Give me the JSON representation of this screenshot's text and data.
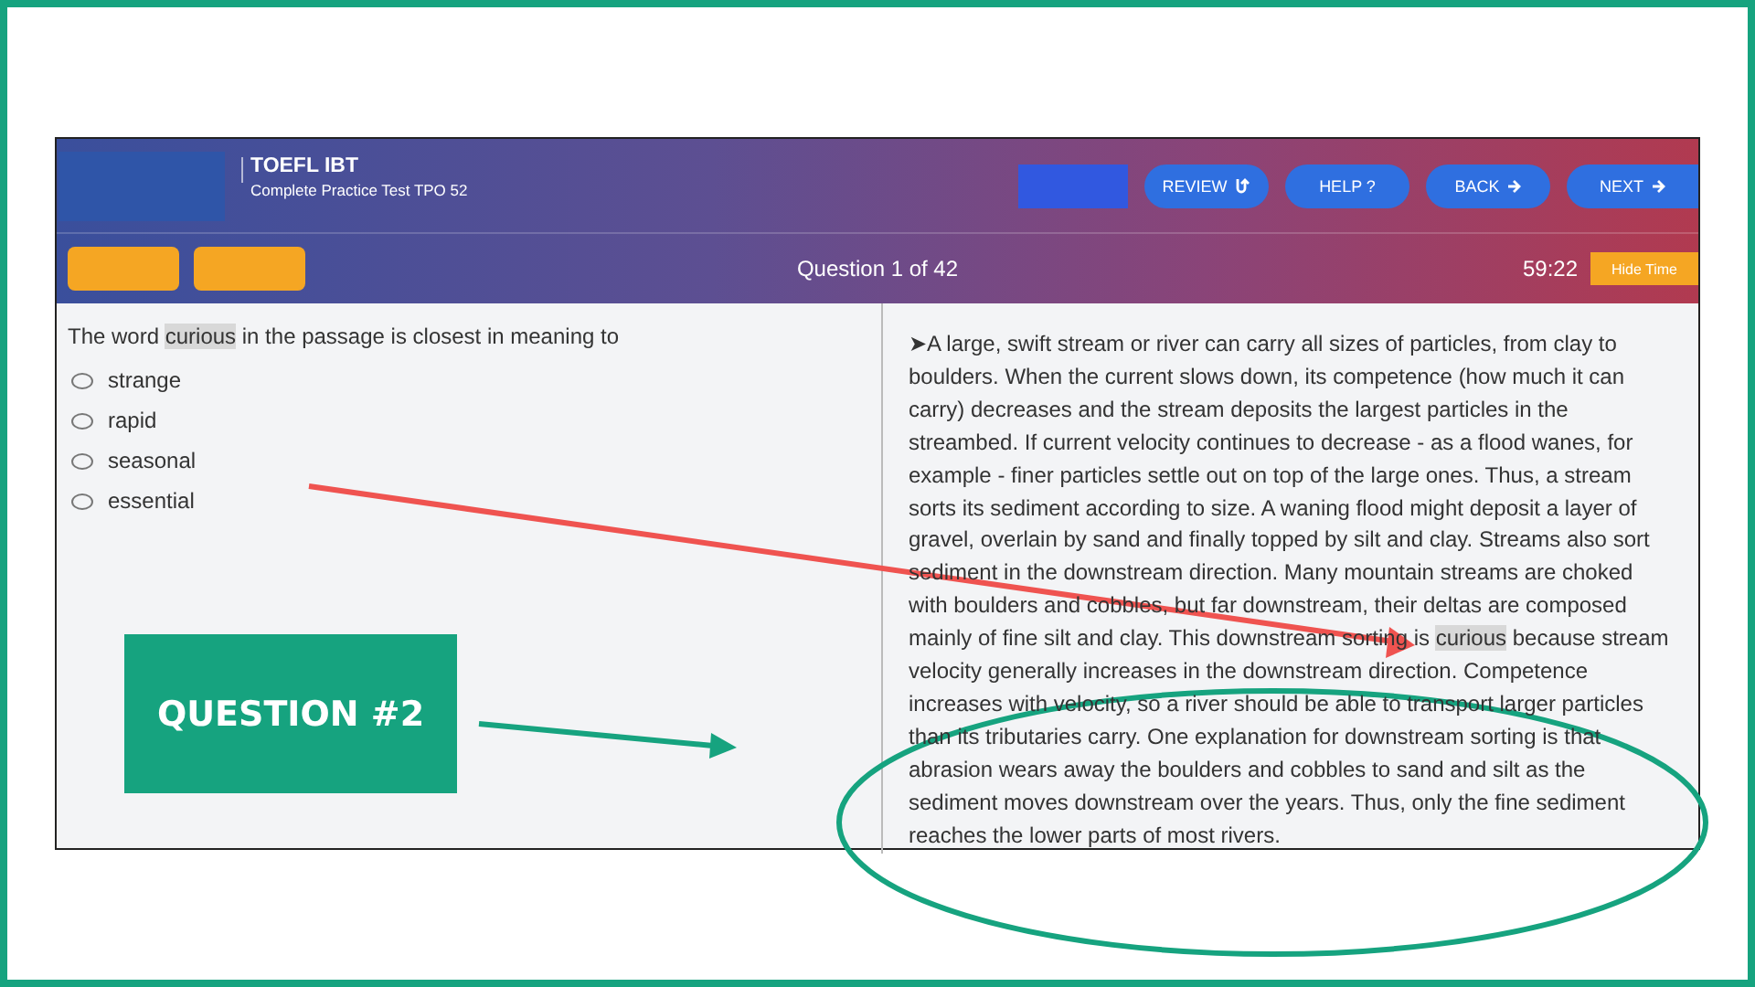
{
  "header": {
    "title": "TOEFL IBT",
    "subtitle": "Complete Practice Test TPO 52",
    "buttons": [
      {
        "kind": "blank"
      },
      {
        "kind": "review",
        "label": "REVIEW"
      },
      {
        "kind": "help",
        "label": "HELP ?"
      },
      {
        "kind": "back",
        "label": "BACK"
      },
      {
        "kind": "next",
        "label": "NEXT"
      }
    ]
  },
  "subheader": {
    "progress": "Question 1 of 42",
    "timer": "59:22",
    "timer_button": "Hide Time"
  },
  "question": {
    "segments": [
      {
        "text": "The word ",
        "highlighted": false
      },
      {
        "text": "curious",
        "highlighted": true
      },
      {
        "text": " in the passage is closest in meaning to",
        "highlighted": false
      }
    ],
    "options": [
      {
        "label": "strange",
        "selected": false
      },
      {
        "label": "rapid",
        "selected": false
      },
      {
        "label": "seasonal",
        "selected": false
      },
      {
        "label": "essential",
        "selected": false
      }
    ]
  },
  "passage": {
    "segments": [
      {
        "text": "➤A large, swift stream or river can carry all sizes of particles, from clay to boulders. When the current slows down, its competence (how much it can carry) decreases and the stream deposits the largest particles in the streambed. If current velocity continues to decrease - as a flood wanes, for example - finer particles settle out on top of the large ones. Thus, a stream sorts its sediment according to size. A waning flood might deposit a layer of gravel, overlain by sand and finally topped by silt and clay. Streams also sort sediment in the downstream direction. Many mountain streams are choked with boulders and cobbles, but far downstream, their deltas are composed mainly of fine silt and clay. This downstream sorting is ",
        "highlighted": false
      },
      {
        "text": "curious",
        "highlighted": true
      },
      {
        "text": " because stream velocity generally increases in the downstream direction. Competence increases with velocity, so a river should be able to transport larger particles than its tributaries carry. One explanation for downstream sorting is that abrasion wears away the boulders and cobbles to sand and silt as the sediment moves downstream over the years. Thus, only the fine sediment reaches the lower parts of most rivers.",
        "highlighted": false
      }
    ]
  },
  "annotation": {
    "label": "QUESTION #2"
  }
}
